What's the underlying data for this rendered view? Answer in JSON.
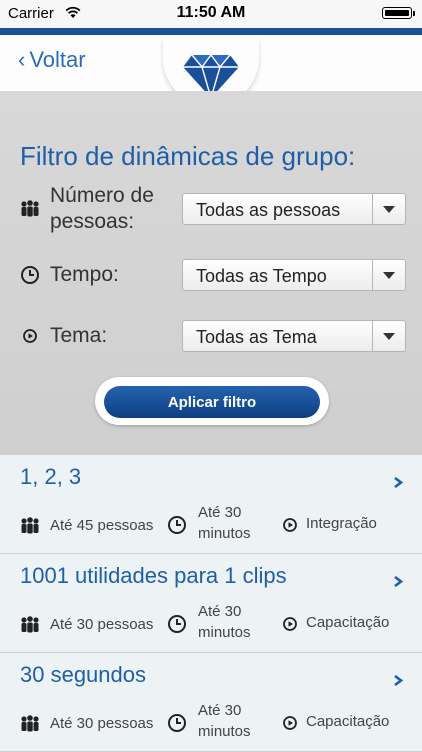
{
  "status_bar": {
    "carrier": "Carrier",
    "time": "11:50 AM"
  },
  "nav": {
    "back_label": "Voltar",
    "logo": "diamond-logo"
  },
  "filter": {
    "title": "Filtro de dinâmicas de grupo:",
    "rows": [
      {
        "icon": "people-icon",
        "label_line1": "Número de",
        "label_line2": "pessoas:",
        "value": "Todas as pessoas"
      },
      {
        "icon": "clock-icon",
        "label": "Tempo:",
        "value": "Todas as Tempo"
      },
      {
        "icon": "play-circle-icon",
        "label": "Tema:",
        "value": "Todas as Tema"
      }
    ],
    "apply_label": "Aplicar filtro"
  },
  "items": [
    {
      "title": "1, 2, 3",
      "people": "Até 45 pessoas",
      "time_line1": "Até 30",
      "time_line2": "minutos",
      "theme": "Integração"
    },
    {
      "title": "1001 utilidades para 1 clips",
      "people": "Até 30 pessoas",
      "time_line1": "Até 30",
      "time_line2": "minutos",
      "theme": "Capacitação"
    },
    {
      "title": "30 segundos",
      "people": "Até 30 pessoas",
      "time_line1": "Até 30",
      "time_line2": "minutos",
      "theme": "Capacitação"
    }
  ],
  "colors": {
    "accent": "#1f5fa8",
    "header_strip": "#1a4f99",
    "button": "#1a4f99"
  }
}
